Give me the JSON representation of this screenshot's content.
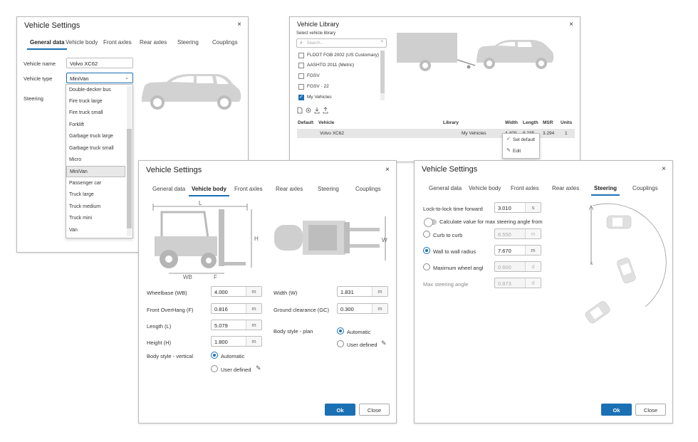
{
  "dialog_general": {
    "title": "Vehicle Settings",
    "close": "×",
    "tabs": [
      "General data",
      "Vehicle body",
      "Front axles",
      "Rear axles",
      "Steering",
      "Couplings"
    ],
    "vehicle_name_label": "Vehicle name",
    "vehicle_name_value": "Volvo XC62",
    "vehicle_type_label": "Vehicle type",
    "vehicle_type_value": "MiniVan",
    "steering_label": "Steering",
    "dropdown_options": [
      "Double-decker bus",
      "Fire truck large",
      "Fire truck small",
      "Forklift",
      "Garbage truck large",
      "Garbage truck small",
      "Micro",
      "MiniVan",
      "Passenger car",
      "Truck large",
      "Truck medium",
      "Truck mini",
      "Van"
    ]
  },
  "dialog_library": {
    "title": "Vehicle Library",
    "close": "×",
    "select_label": "Select vehicle library",
    "search_placeholder": "Search...",
    "libraries": [
      {
        "name": "FLDOT FGB 2002 (US Customary)",
        "checked": false
      },
      {
        "name": "AASHTO 2011 (Metric)",
        "checked": false
      },
      {
        "name": "FGSV",
        "checked": false
      },
      {
        "name": "FGSV - 22",
        "checked": false
      },
      {
        "name": "My Vehicles",
        "checked": true
      }
    ],
    "columns": [
      "Default",
      "Vehicle",
      "Library",
      "Width",
      "Length",
      "MSR",
      "Units"
    ],
    "row": {
      "vehicle": "Volvo XC62",
      "library": "My Vehicles",
      "width": "4.409",
      "length": "8.235",
      "msr": "3.294",
      "units": "1"
    },
    "context_menu": [
      "Set default",
      "Edit"
    ]
  },
  "dialog_body": {
    "title": "Vehicle Settings",
    "close": "×",
    "tabs": [
      "General data",
      "Vehicle body",
      "Front axles",
      "Rear axles",
      "Steering",
      "Couplings"
    ],
    "dims": {
      "L": "L",
      "H": "H",
      "WB": "WB",
      "F": "F",
      "W": "W"
    },
    "fields": [
      {
        "label": "Wheelbase (WB)",
        "value": "4.000",
        "unit": "m"
      },
      {
        "label": "Front OverHang (F)",
        "value": "0.816",
        "unit": "m"
      },
      {
        "label": "Length (L)",
        "value": "5.079",
        "unit": "m"
      },
      {
        "label": "Height (H)",
        "value": "1.800",
        "unit": "m"
      }
    ],
    "fields_right": [
      {
        "label": "Width (W)",
        "value": "1.831",
        "unit": "m"
      },
      {
        "label": "Ground clearance (GC)",
        "value": "0.300",
        "unit": "m"
      }
    ],
    "body_style_vertical_label": "Body style - vertical",
    "body_style_plan_label": "Body style - plan",
    "automatic": "Automatic",
    "user_defined": "User defined",
    "ok": "Ok",
    "close_button": "Close"
  },
  "dialog_steering": {
    "title": "Vehicle Settings",
    "close": "×",
    "tabs": [
      "General data",
      "Vehicle body",
      "Front axles",
      "Rear axles",
      "Steering",
      "Couplings"
    ],
    "lock_label": "Lock-to-lock time forward",
    "lock_value": "3.010",
    "lock_unit": "s",
    "calc_label": "Calculate value for max steering angle from",
    "options": [
      {
        "label": "Curb to curb",
        "value": "6.550",
        "unit": "m",
        "selected": false
      },
      {
        "label": "Wall to wall radius",
        "value": "7.670",
        "unit": "m",
        "selected": true
      },
      {
        "label": "Maximum wheel angl",
        "value": "0.600",
        "unit": "d",
        "selected": false
      }
    ],
    "max_angle_label": "Max steering angle",
    "max_angle_value": "0.873",
    "max_angle_unit": "d",
    "ok": "Ok",
    "close_button": "Close"
  }
}
